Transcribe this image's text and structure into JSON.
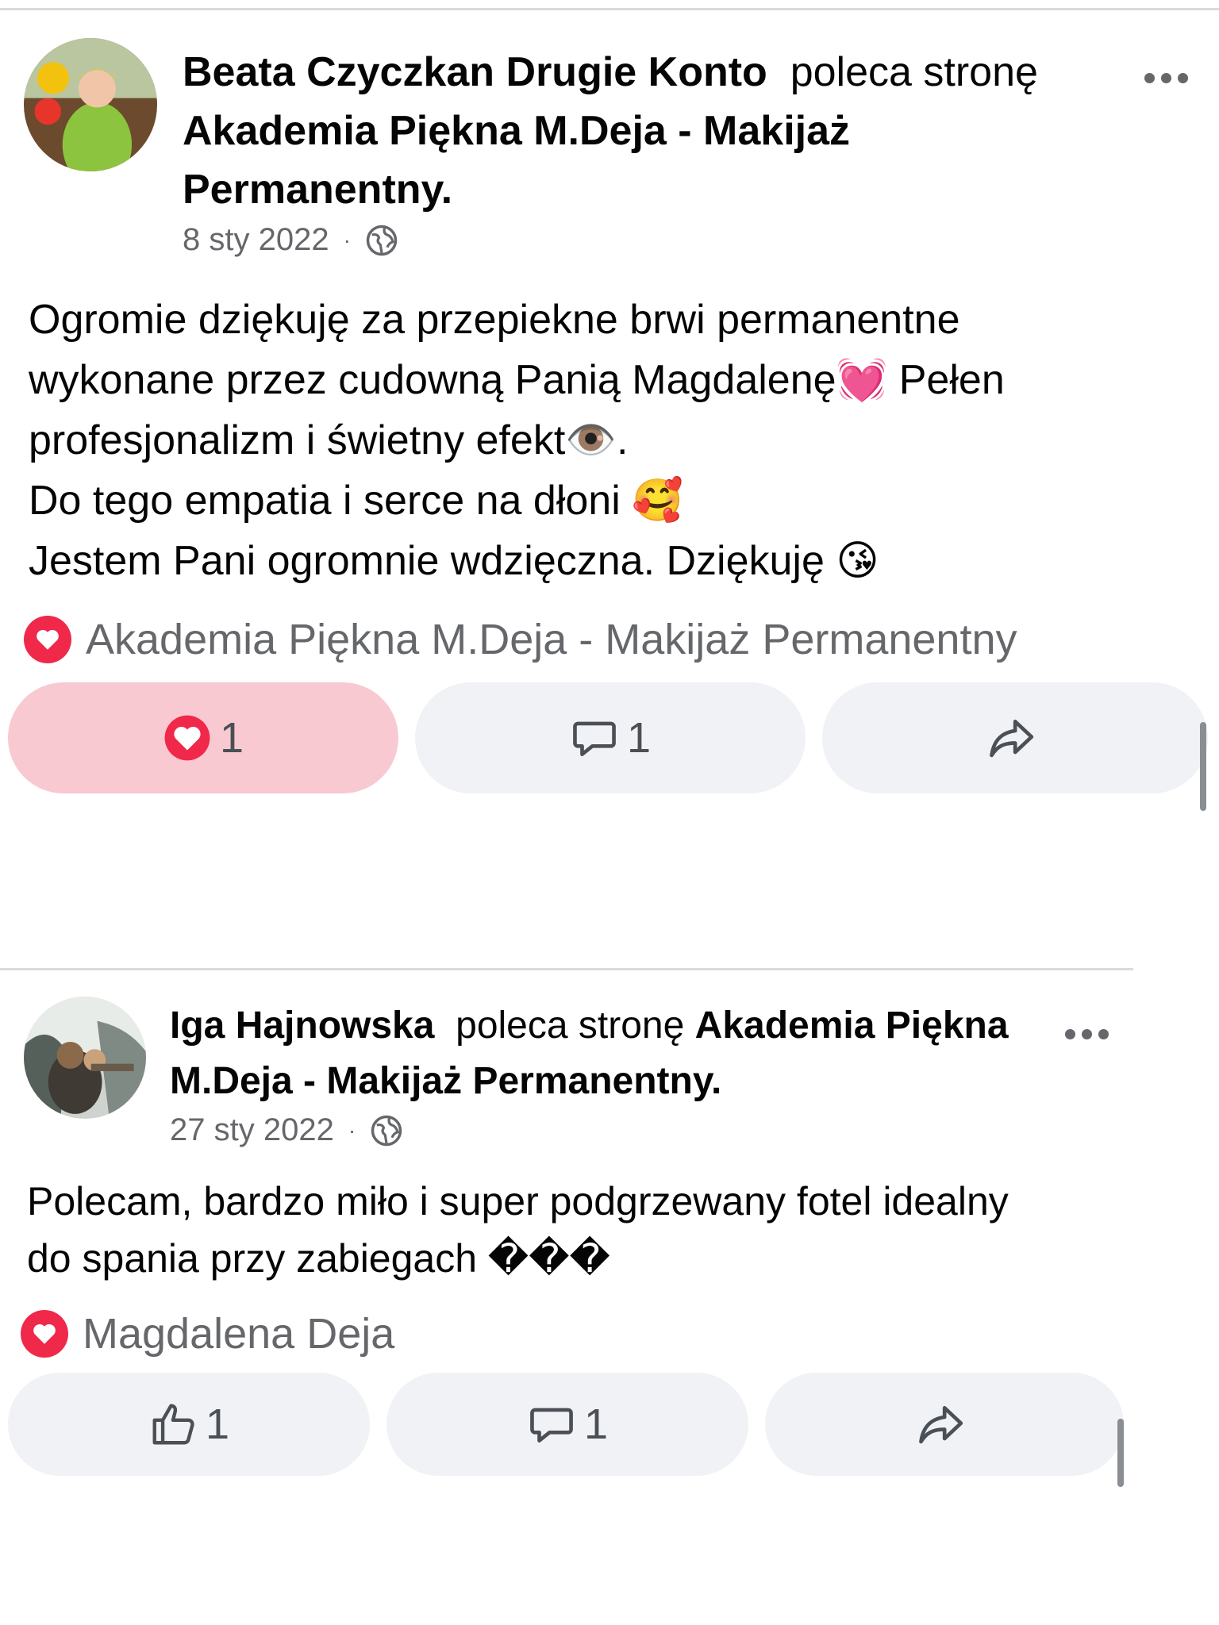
{
  "posts": [
    {
      "author": "Beata Czyczkan Drugie Konto",
      "verb": "poleca stronę",
      "page": "Akademia Piękna M.Deja  - Makijaż Permanentny.",
      "date": "8 sty 2022",
      "dot": "·",
      "body": "Ogromie dziękuję za przepiekne brwi permanentne\nwykonane przez cudowną Panią Magdalenę💓 Pełen\nprofesjonalizm i świetny efekt👁️.\nDo tego empatia i serce na dłoni 🥰\nJestem Pani ogromnie wdzięczna. Dziękuję 😘",
      "recommended_by": "Akademia Piękna M.Deja  - Makijaż Permanentny",
      "reaction_count": "1",
      "comment_count": "1"
    },
    {
      "author": "Iga Hajnowska",
      "verb": "poleca stronę",
      "page": "Akademia Piękna M.Deja  - Makijaż Permanentny.",
      "date": "27 sty 2022",
      "dot": "·",
      "body": "Polecam, bardzo miło i super podgrzewany fotel idealny\ndo spania przy zabiegach ���",
      "recommended_by": "Magdalena Deja",
      "reaction_count": "1",
      "comment_count": "1"
    }
  ],
  "colors": {
    "text": "#050505",
    "meta": "#65676b",
    "heart": "#f0284a",
    "liked_pill": "#f9c9d1",
    "pill": "#f0f2f5"
  }
}
